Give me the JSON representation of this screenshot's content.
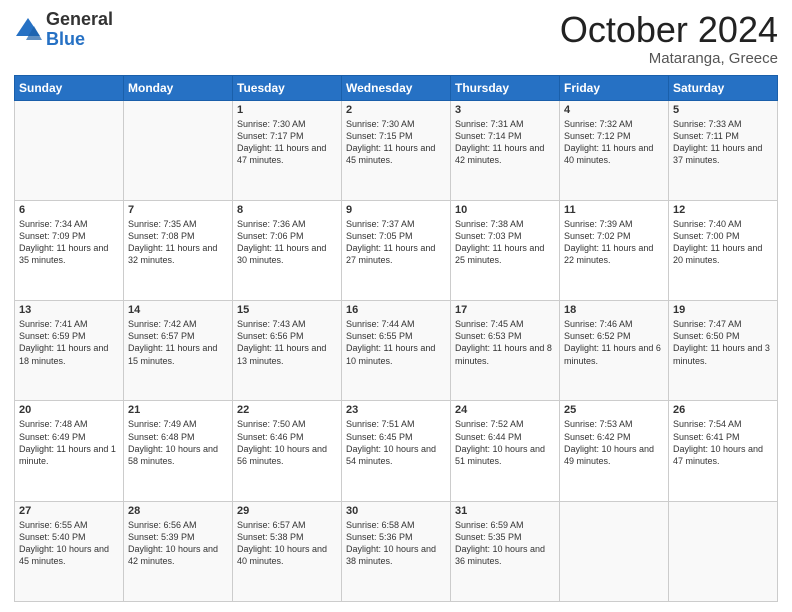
{
  "header": {
    "logo_general": "General",
    "logo_blue": "Blue",
    "title": "October 2024",
    "location": "Mataranga, Greece"
  },
  "weekdays": [
    "Sunday",
    "Monday",
    "Tuesday",
    "Wednesday",
    "Thursday",
    "Friday",
    "Saturday"
  ],
  "weeks": [
    [
      {
        "day": "",
        "info": ""
      },
      {
        "day": "",
        "info": ""
      },
      {
        "day": "1",
        "info": "Sunrise: 7:30 AM\nSunset: 7:17 PM\nDaylight: 11 hours and 47 minutes."
      },
      {
        "day": "2",
        "info": "Sunrise: 7:30 AM\nSunset: 7:15 PM\nDaylight: 11 hours and 45 minutes."
      },
      {
        "day": "3",
        "info": "Sunrise: 7:31 AM\nSunset: 7:14 PM\nDaylight: 11 hours and 42 minutes."
      },
      {
        "day": "4",
        "info": "Sunrise: 7:32 AM\nSunset: 7:12 PM\nDaylight: 11 hours and 40 minutes."
      },
      {
        "day": "5",
        "info": "Sunrise: 7:33 AM\nSunset: 7:11 PM\nDaylight: 11 hours and 37 minutes."
      }
    ],
    [
      {
        "day": "6",
        "info": "Sunrise: 7:34 AM\nSunset: 7:09 PM\nDaylight: 11 hours and 35 minutes."
      },
      {
        "day": "7",
        "info": "Sunrise: 7:35 AM\nSunset: 7:08 PM\nDaylight: 11 hours and 32 minutes."
      },
      {
        "day": "8",
        "info": "Sunrise: 7:36 AM\nSunset: 7:06 PM\nDaylight: 11 hours and 30 minutes."
      },
      {
        "day": "9",
        "info": "Sunrise: 7:37 AM\nSunset: 7:05 PM\nDaylight: 11 hours and 27 minutes."
      },
      {
        "day": "10",
        "info": "Sunrise: 7:38 AM\nSunset: 7:03 PM\nDaylight: 11 hours and 25 minutes."
      },
      {
        "day": "11",
        "info": "Sunrise: 7:39 AM\nSunset: 7:02 PM\nDaylight: 11 hours and 22 minutes."
      },
      {
        "day": "12",
        "info": "Sunrise: 7:40 AM\nSunset: 7:00 PM\nDaylight: 11 hours and 20 minutes."
      }
    ],
    [
      {
        "day": "13",
        "info": "Sunrise: 7:41 AM\nSunset: 6:59 PM\nDaylight: 11 hours and 18 minutes."
      },
      {
        "day": "14",
        "info": "Sunrise: 7:42 AM\nSunset: 6:57 PM\nDaylight: 11 hours and 15 minutes."
      },
      {
        "day": "15",
        "info": "Sunrise: 7:43 AM\nSunset: 6:56 PM\nDaylight: 11 hours and 13 minutes."
      },
      {
        "day": "16",
        "info": "Sunrise: 7:44 AM\nSunset: 6:55 PM\nDaylight: 11 hours and 10 minutes."
      },
      {
        "day": "17",
        "info": "Sunrise: 7:45 AM\nSunset: 6:53 PM\nDaylight: 11 hours and 8 minutes."
      },
      {
        "day": "18",
        "info": "Sunrise: 7:46 AM\nSunset: 6:52 PM\nDaylight: 11 hours and 6 minutes."
      },
      {
        "day": "19",
        "info": "Sunrise: 7:47 AM\nSunset: 6:50 PM\nDaylight: 11 hours and 3 minutes."
      }
    ],
    [
      {
        "day": "20",
        "info": "Sunrise: 7:48 AM\nSunset: 6:49 PM\nDaylight: 11 hours and 1 minute."
      },
      {
        "day": "21",
        "info": "Sunrise: 7:49 AM\nSunset: 6:48 PM\nDaylight: 10 hours and 58 minutes."
      },
      {
        "day": "22",
        "info": "Sunrise: 7:50 AM\nSunset: 6:46 PM\nDaylight: 10 hours and 56 minutes."
      },
      {
        "day": "23",
        "info": "Sunrise: 7:51 AM\nSunset: 6:45 PM\nDaylight: 10 hours and 54 minutes."
      },
      {
        "day": "24",
        "info": "Sunrise: 7:52 AM\nSunset: 6:44 PM\nDaylight: 10 hours and 51 minutes."
      },
      {
        "day": "25",
        "info": "Sunrise: 7:53 AM\nSunset: 6:42 PM\nDaylight: 10 hours and 49 minutes."
      },
      {
        "day": "26",
        "info": "Sunrise: 7:54 AM\nSunset: 6:41 PM\nDaylight: 10 hours and 47 minutes."
      }
    ],
    [
      {
        "day": "27",
        "info": "Sunrise: 6:55 AM\nSunset: 5:40 PM\nDaylight: 10 hours and 45 minutes."
      },
      {
        "day": "28",
        "info": "Sunrise: 6:56 AM\nSunset: 5:39 PM\nDaylight: 10 hours and 42 minutes."
      },
      {
        "day": "29",
        "info": "Sunrise: 6:57 AM\nSunset: 5:38 PM\nDaylight: 10 hours and 40 minutes."
      },
      {
        "day": "30",
        "info": "Sunrise: 6:58 AM\nSunset: 5:36 PM\nDaylight: 10 hours and 38 minutes."
      },
      {
        "day": "31",
        "info": "Sunrise: 6:59 AM\nSunset: 5:35 PM\nDaylight: 10 hours and 36 minutes."
      },
      {
        "day": "",
        "info": ""
      },
      {
        "day": "",
        "info": ""
      }
    ]
  ]
}
